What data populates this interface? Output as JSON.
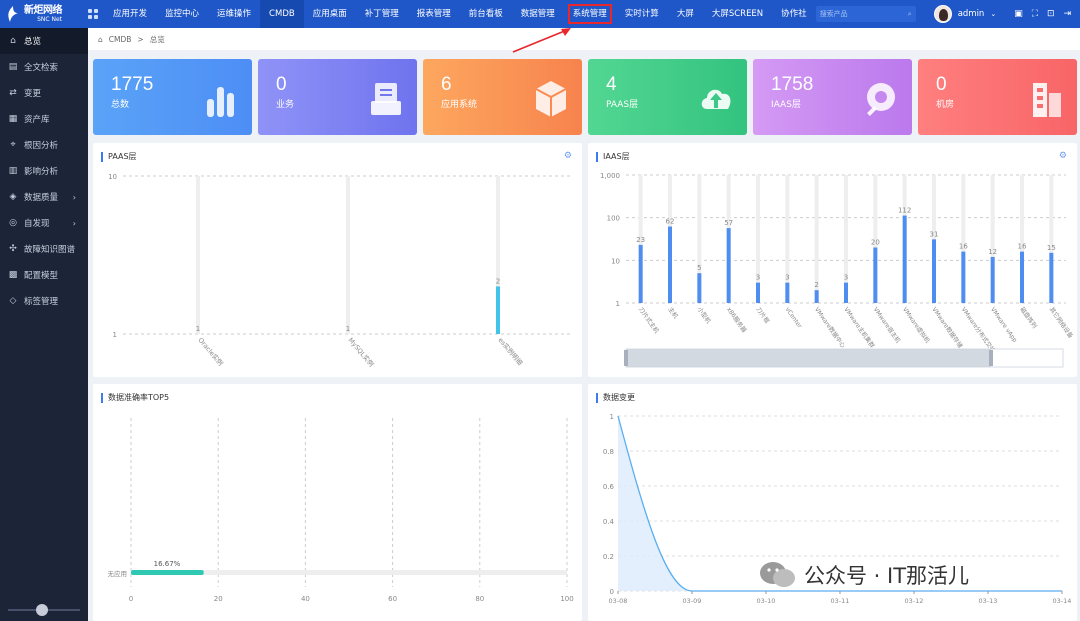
{
  "brand": {
    "name": "新炬网络",
    "sub": "SNC Net"
  },
  "nav": {
    "items": [
      "应用开发",
      "监控中心",
      "运维操作",
      "CMDB",
      "应用桌面",
      "补丁管理",
      "报表管理",
      "前台看板",
      "数据管理",
      "系统管理",
      "实时计算",
      "大屏",
      "大屏SCREEN",
      "协作社"
    ],
    "active_index": 3,
    "highlight_index": 9,
    "search_placeholder": "搜索产品"
  },
  "user": {
    "name": "admin"
  },
  "sidebar": {
    "items": [
      {
        "label": "总览",
        "icon": "home-icon",
        "active": true
      },
      {
        "label": "全文检索",
        "icon": "doc-search-icon"
      },
      {
        "label": "变更",
        "icon": "change-icon"
      },
      {
        "label": "资产库",
        "icon": "asset-icon"
      },
      {
        "label": "根因分析",
        "icon": "root-cause-icon"
      },
      {
        "label": "影响分析",
        "icon": "impact-icon"
      },
      {
        "label": "数据质量",
        "icon": "quality-icon",
        "arrow": true
      },
      {
        "label": "自发现",
        "icon": "discover-icon",
        "arrow": true
      },
      {
        "label": "故障知识图谱",
        "icon": "knowledge-graph-icon"
      },
      {
        "label": "配置模型",
        "icon": "model-icon"
      },
      {
        "label": "标签管理",
        "icon": "tag-icon"
      }
    ]
  },
  "breadcrumb": {
    "home_icon": "home-icon",
    "root": "CMDB",
    "sep": ">",
    "current": "总览"
  },
  "stats": [
    {
      "value": "1775",
      "label": "总数",
      "color_from": "#5aa3f8",
      "color_to": "#4d8ef5",
      "icon": "bar-chart-icon"
    },
    {
      "value": "0",
      "label": "业务",
      "color_from": "#8f93f7",
      "color_to": "#6f73ee",
      "icon": "inbox-icon"
    },
    {
      "value": "6",
      "label": "应用系统",
      "color_from": "#fda75f",
      "color_to": "#f7834d",
      "icon": "cube-icon"
    },
    {
      "value": "4",
      "label": "PAAS层",
      "color_from": "#52d792",
      "color_to": "#33c37f",
      "icon": "cloud-upload-icon"
    },
    {
      "value": "1758",
      "label": "IAAS层",
      "color_from": "#d49af4",
      "color_to": "#bb79ec",
      "icon": "tool-icon"
    },
    {
      "value": "0",
      "label": "机房",
      "color_from": "#ff7f7f",
      "color_to": "#f86567",
      "icon": "building-icon"
    }
  ],
  "panels": {
    "paas_title": "PAAS层",
    "iaas_title": "IAAS层",
    "accuracy_title": "数据准确率TOP5",
    "change_title": "数据变更"
  },
  "watermark": "公众号 · IT那活儿",
  "chart_data": [
    {
      "type": "bar",
      "title": "PAAS层",
      "categories": [
        "Oracle实例",
        "MySQL实例",
        "es实例明细"
      ],
      "values": [
        1,
        1,
        2
      ],
      "y_ticks": [
        "10",
        "1"
      ],
      "y_scale": "log",
      "ylim": [
        1,
        10
      ]
    },
    {
      "type": "bar",
      "title": "IAAS层",
      "categories": [
        "刀片式主机",
        "主机",
        "小型机",
        "x86服务器",
        "刀片框",
        "vCenter",
        "VMware数据中心",
        "VMware主机集群",
        "VMware宿主机",
        "VMware虚拟机",
        "VMware数据存储",
        "VMware分布式交换机",
        "VMware vApp",
        "磁盘阵列",
        "其它网络设备"
      ],
      "values": [
        23,
        62,
        5,
        57,
        3,
        3,
        2,
        3,
        20,
        112,
        31,
        16,
        12,
        16,
        15
      ],
      "y_ticks": [
        "1,000",
        "100",
        "10",
        "1"
      ],
      "y_scale": "log",
      "ylim": [
        1,
        1000
      ]
    },
    {
      "type": "bar",
      "title": "数据准确率TOP5",
      "orientation": "horizontal",
      "categories": [
        "无应用"
      ],
      "values": [
        16.67
      ],
      "value_labels": [
        "16.67%"
      ],
      "x_ticks": [
        "0",
        "20",
        "40",
        "60",
        "80",
        "100"
      ],
      "xlim": [
        0,
        100
      ]
    },
    {
      "type": "area",
      "title": "数据变更",
      "x": [
        "03-08",
        "03-09",
        "03-10",
        "03-11",
        "03-12",
        "03-13",
        "03-14"
      ],
      "values": [
        1,
        0,
        0,
        0,
        0,
        0,
        0
      ],
      "y_ticks": [
        "1",
        "0.8",
        "0.6",
        "0.4",
        "0.2",
        "0"
      ],
      "ylim": [
        0,
        1
      ]
    }
  ]
}
